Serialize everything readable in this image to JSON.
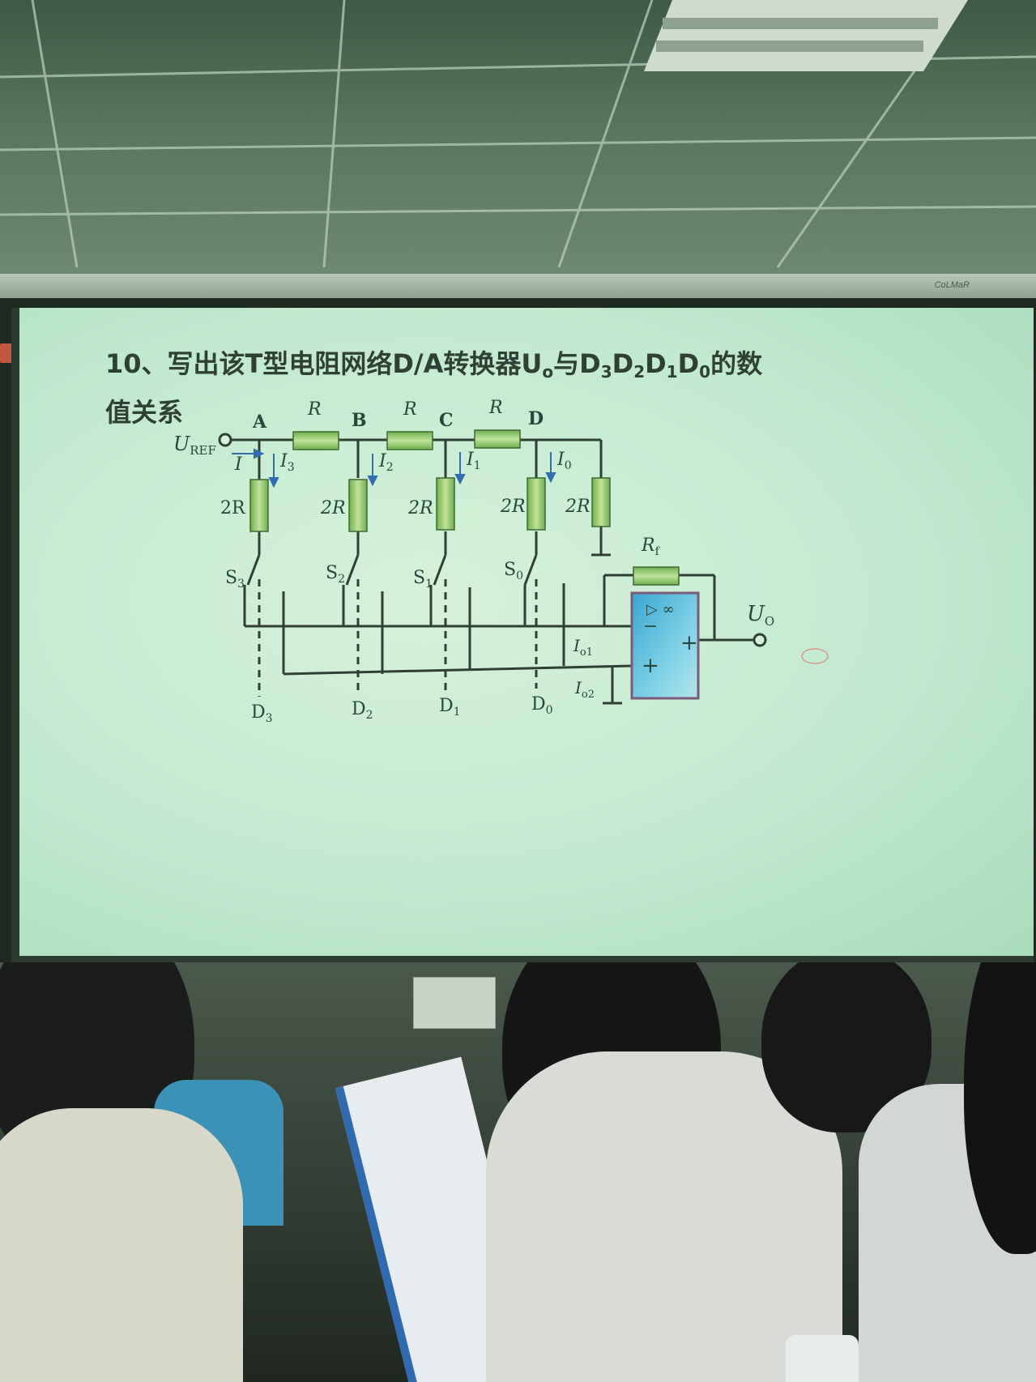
{
  "projector_brand": "CoLMaR",
  "slide": {
    "title_line1_prefix": "10、写出该T型电阻网络D/A转换器U",
    "title_line1_mid": "与D",
    "title_line2": "值关系",
    "title_subscripts": [
      "o",
      "3",
      "2",
      "1",
      "0"
    ],
    "title_d_letters": [
      "D",
      "D",
      "D"
    ],
    "title_suffix": "的数"
  },
  "circuit": {
    "input_label": "U",
    "input_label_sub": "REF",
    "current_I": "I",
    "nodes": [
      "A",
      "B",
      "C",
      "D"
    ],
    "series_resistor_label": "R",
    "branch_currents": [
      {
        "main": "I",
        "sub": "3"
      },
      {
        "main": "I",
        "sub": "2"
      },
      {
        "main": "I",
        "sub": "1"
      },
      {
        "main": "I",
        "sub": "0"
      }
    ],
    "shunt_labels": [
      "2R",
      "2R",
      "2R",
      "2R",
      "2R"
    ],
    "switches": [
      {
        "main": "S",
        "sub": "3"
      },
      {
        "main": "S",
        "sub": "2"
      },
      {
        "main": "S",
        "sub": "1"
      },
      {
        "main": "S",
        "sub": "0"
      }
    ],
    "digital_inputs": [
      {
        "main": "D",
        "sub": "3"
      },
      {
        "main": "D",
        "sub": "2"
      },
      {
        "main": "D",
        "sub": "1"
      },
      {
        "main": "D",
        "sub": "0"
      }
    ],
    "feedback_label": "R",
    "feedback_sub": "f",
    "output_label": "U",
    "output_sub": "O",
    "out_current_1": "I",
    "out_current_1_sub": "o1",
    "out_current_2": "I",
    "out_current_2_sub": "o2",
    "opamp_gain_symbol": "▷ ∞",
    "opamp_minus": "−",
    "opamp_plus_in": "+",
    "opamp_plus_out": "+"
  }
}
